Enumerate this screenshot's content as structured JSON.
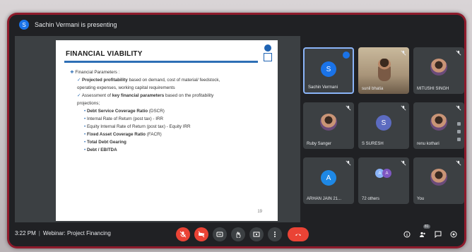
{
  "presenting": {
    "text": "Sachin Vermani is presenting",
    "avatar_letter": "S"
  },
  "slide": {
    "title": "FINANCIAL VIABILITY",
    "lines": [
      {
        "level": "l1",
        "bullet": "❖",
        "text": "Financial Parameters :"
      },
      {
        "level": "l2",
        "bullet": "✓",
        "bold": "Projected profitability",
        "text": " based on demand, cost of material/ feedstock,"
      },
      {
        "level": "l2",
        "bullet": "",
        "text": "operating expenses, working capital requirements"
      },
      {
        "level": "l2",
        "bullet": "✓",
        "text": "Assessment of ",
        "bold": "key financial parameters",
        "text2": " based on the profitability"
      },
      {
        "level": "l2",
        "bullet": "",
        "text": "projections;"
      },
      {
        "level": "l3",
        "bullet": "•",
        "bold": "Debt Service Coverage Ratio",
        "text": " (DSCR)"
      },
      {
        "level": "l3",
        "bullet": "•",
        "text": "Internal Rate of Return (post tax) - IRR"
      },
      {
        "level": "l3",
        "bullet": "•",
        "text": "Equity Internal Rate of Return (post tax) - Equity IRR"
      },
      {
        "level": "l3",
        "bullet": "•",
        "bold": "Fixed Asset Coverage Ratio",
        "text": " (FACR)"
      },
      {
        "level": "l3",
        "bullet": "•",
        "bold": "Total Debt Gearing",
        "text": ""
      },
      {
        "level": "l3",
        "bullet": "•",
        "bold": "Debt / EBITDA",
        "text": ""
      }
    ],
    "page_number": "19"
  },
  "participants": [
    {
      "name": "Sachin Vermani",
      "type": "avatar",
      "letter": "S",
      "color": "#1a73e8",
      "active": true,
      "speaking": true
    },
    {
      "name": "sunil bhatia",
      "type": "video",
      "muted": true
    },
    {
      "name": "MITUSHI SINGH",
      "type": "photo",
      "muted": true
    },
    {
      "name": "Ruby Sanger",
      "type": "photo",
      "muted": true
    },
    {
      "name": "S SURESH",
      "type": "avatar",
      "letter": "S",
      "color": "#5c6bc0",
      "muted": true
    },
    {
      "name": "renu kothari",
      "type": "photo",
      "muted": true
    },
    {
      "name": "ARHAN JAIN 21...",
      "type": "avatar",
      "letter": "A",
      "color": "#1e88e5",
      "muted": true
    },
    {
      "name": "72 others",
      "type": "others",
      "letters": [
        "A",
        "A"
      ],
      "muted": true
    },
    {
      "name": "You",
      "type": "photo",
      "muted": true
    }
  ],
  "controls": {
    "time": "3:22 PM",
    "meeting_name": "Webinar: Project Financing",
    "people_count": "81"
  }
}
